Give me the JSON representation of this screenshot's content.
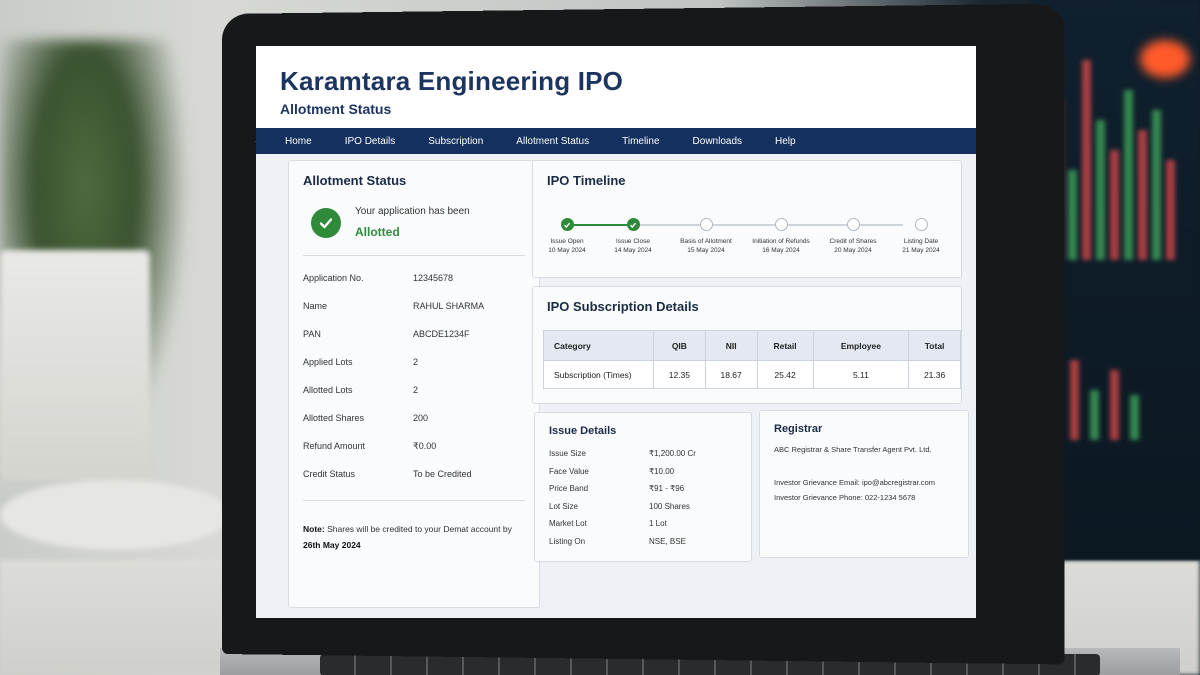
{
  "app": {
    "title": "Karamtara Engineering IPO",
    "subtitle": "Allotment Status"
  },
  "nav": {
    "items": [
      "Home",
      "IPO Details",
      "Subscription",
      "Allotment Status",
      "Timeline",
      "Downloads",
      "Help"
    ]
  },
  "allotment": {
    "title": "Allotment Status",
    "status_line": "Your application has been",
    "status": "Allotted",
    "status_color": "#2f8a3a",
    "rows": [
      {
        "label": "Application No.",
        "value": "12345678"
      },
      {
        "label": "Name",
        "value": "RAHUL SHARMA"
      },
      {
        "label": "PAN",
        "value": "ABCDE1234F"
      },
      {
        "label": "Applied Lots",
        "value": "2"
      },
      {
        "label": "Allotted Lots",
        "value": "2"
      },
      {
        "label": "Allotted Shares",
        "value": "200"
      },
      {
        "label": "Refund Amount",
        "value": "₹0.00"
      },
      {
        "label": "Credit Status",
        "value": "To be Credited"
      }
    ],
    "note_label": "Note:",
    "note_text": "Shares will be credited to your Demat account by",
    "note_date": "26th May 2024"
  },
  "timeline": {
    "title": "IPO Timeline",
    "steps": [
      {
        "label": "Issue Open",
        "date": "10 May 2024",
        "done": true
      },
      {
        "label": "Issue Close",
        "date": "14 May 2024",
        "done": true
      },
      {
        "label": "Basis of Allotment",
        "date": "15 May 2024",
        "done": false
      },
      {
        "label": "Initiation of Refunds",
        "date": "16 May 2024",
        "done": false
      },
      {
        "label": "Credit of Shares",
        "date": "20 May 2024",
        "done": false
      },
      {
        "label": "Listing Date",
        "date": "21 May 2024",
        "done": false
      }
    ]
  },
  "subscription": {
    "title": "IPO Subscription Details",
    "headers": [
      "Category",
      "QIB",
      "NII",
      "Retail",
      "Employee",
      "Total"
    ],
    "row": [
      "Subscription (Times)",
      "12.35",
      "18.67",
      "25.42",
      "5.11",
      "21.36"
    ]
  },
  "issue": {
    "title": "Issue Details",
    "rows": [
      {
        "label": "Issue Size",
        "value": "₹1,200.00 Cr"
      },
      {
        "label": "Face Value",
        "value": "₹10.00"
      },
      {
        "label": "Price Band",
        "value": "₹91 - ₹96"
      },
      {
        "label": "Lot Size",
        "value": "100 Shares"
      },
      {
        "label": "Market Lot",
        "value": "1 Lot"
      },
      {
        "label": "Listing On",
        "value": "NSE, BSE"
      }
    ]
  },
  "registrar": {
    "title": "Registrar",
    "name": "ABC Registrar & Share Transfer Agent Pvt. Ltd.",
    "email": "Investor Grievance Email: ipo@abcregistrar.com",
    "phone": "Investor Grievance Phone: 022-1234 5678"
  },
  "colors": {
    "brand": "#14305e",
    "success": "#2f8a3a"
  }
}
